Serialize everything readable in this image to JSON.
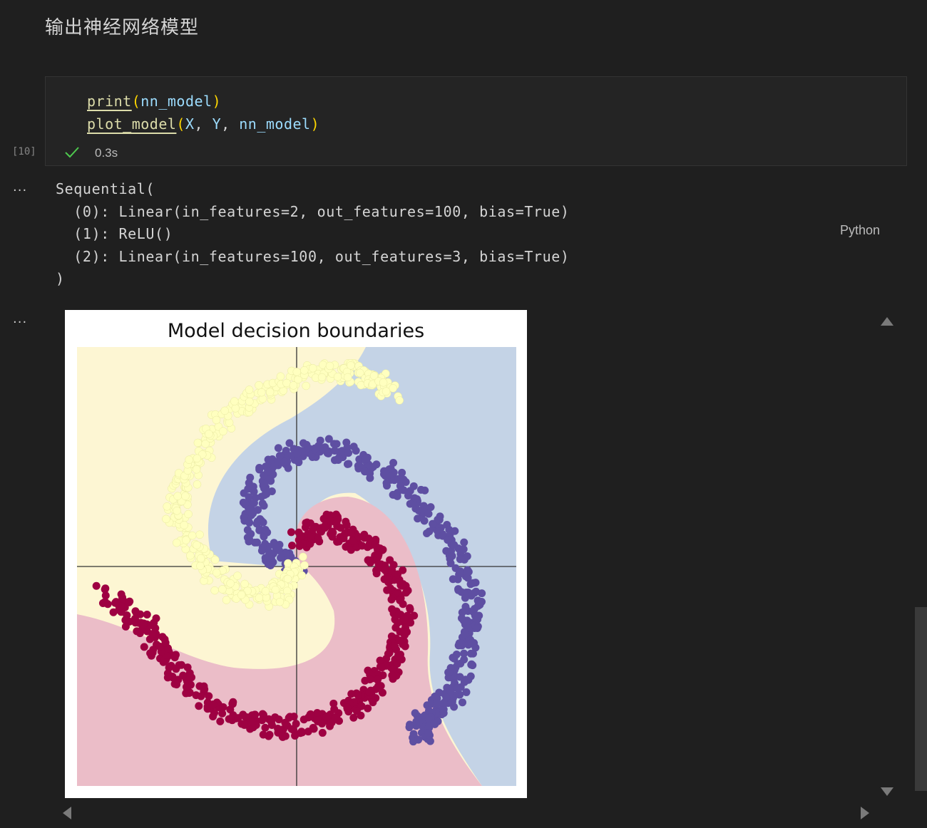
{
  "markdown": {
    "heading": "输出神经网络模型"
  },
  "cell": {
    "execution_count": "[10]",
    "status_icon": "check-icon",
    "exec_time": "0.3s",
    "language": "Python",
    "code": {
      "line1": {
        "fn": "print",
        "open": "(",
        "arg": "nn_model",
        "close": ")"
      },
      "line2": {
        "fn": "plot_model",
        "open": "(",
        "a1": "X",
        "sep1": ", ",
        "a2": "Y",
        "sep2": ", ",
        "a3": "nn_model",
        "close": ")"
      }
    }
  },
  "output": {
    "more_label": "...",
    "text": "Sequential(\n  (0): Linear(in_features=2, out_features=100, bias=True)\n  (1): ReLU()\n  (2): Linear(in_features=100, out_features=3, bias=True)\n)",
    "image_more_label": "..."
  },
  "chart_data": {
    "type": "scatter",
    "title": "Model decision boundaries",
    "xlabel": "",
    "ylabel": "",
    "xlim": [
      -1.25,
      1.25
    ],
    "ylim": [
      -1.25,
      1.25
    ],
    "axis_lines": "x=0 and y=0",
    "grid": false,
    "legend": "none",
    "classes": [
      {
        "id": 0,
        "color": "#9e0142",
        "region_color": "#ebbdc8"
      },
      {
        "id": 1,
        "color": "#5e4fa2",
        "region_color": "#c4d3e6"
      },
      {
        "id": 2,
        "color": "#ffffbf",
        "region_color": "#fdf6d3"
      }
    ],
    "series": [
      {
        "class": 0,
        "description_points": "spiral arm",
        "points": [
          [
            0.02,
            0.15
          ],
          [
            0.2,
            0.25
          ],
          [
            0.4,
            0.12
          ],
          [
            0.55,
            -0.05
          ],
          [
            0.62,
            -0.3
          ],
          [
            0.55,
            -0.55
          ],
          [
            0.38,
            -0.75
          ],
          [
            0.15,
            -0.88
          ],
          [
            -0.15,
            -0.92
          ],
          [
            -0.45,
            -0.8
          ],
          [
            -0.7,
            -0.6
          ],
          [
            -0.85,
            -0.35
          ],
          [
            -1.1,
            -0.15
          ]
        ]
      },
      {
        "class": 1,
        "description_points": "spiral arm",
        "points": [
          [
            0.0,
            0.0
          ],
          [
            -0.22,
            0.12
          ],
          [
            -0.25,
            0.4
          ],
          [
            -0.1,
            0.62
          ],
          [
            0.15,
            0.68
          ],
          [
            0.42,
            0.6
          ],
          [
            0.68,
            0.38
          ],
          [
            0.9,
            0.1
          ],
          [
            1.0,
            -0.2
          ],
          [
            0.98,
            -0.45
          ],
          [
            0.9,
            -0.7
          ],
          [
            0.75,
            -0.85
          ],
          [
            0.7,
            -0.95
          ]
        ]
      },
      {
        "class": 2,
        "description_points": "spiral arm",
        "points": [
          [
            0.0,
            0.0
          ],
          [
            -0.1,
            -0.18
          ],
          [
            -0.35,
            -0.15
          ],
          [
            -0.55,
            0.05
          ],
          [
            -0.7,
            0.3
          ],
          [
            -0.6,
            0.55
          ],
          [
            -0.45,
            0.8
          ],
          [
            -0.2,
            1.0
          ],
          [
            0.1,
            1.1
          ],
          [
            0.35,
            1.1
          ],
          [
            0.55,
            1.0
          ]
        ]
      }
    ]
  }
}
